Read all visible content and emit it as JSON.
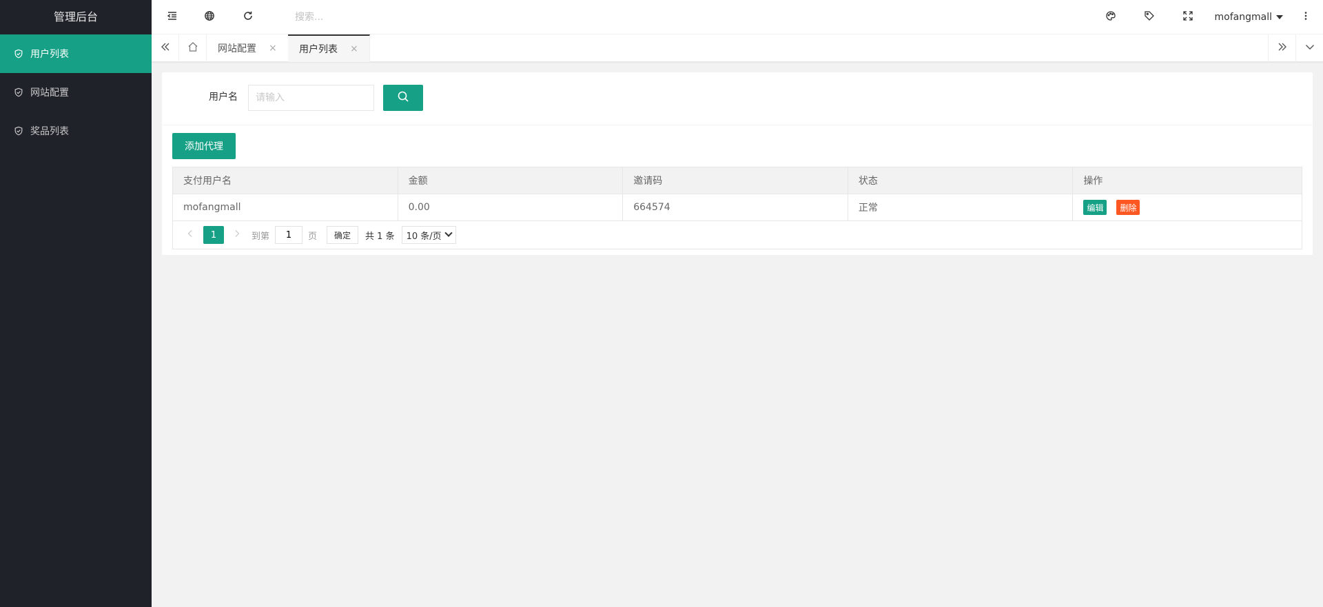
{
  "app": {
    "title": "管理后台"
  },
  "sidebar": {
    "items": [
      {
        "label": "用户列表",
        "active": true
      },
      {
        "label": "网站配置",
        "active": false
      },
      {
        "label": "奖品列表",
        "active": false
      }
    ]
  },
  "header": {
    "search_placeholder": "搜索...",
    "username": "mofangmall"
  },
  "tabs": {
    "items": [
      {
        "label": "网站配置",
        "close": "×"
      },
      {
        "label": "用户列表",
        "close": "×"
      }
    ]
  },
  "filter": {
    "username_label": "用户名",
    "username_placeholder": "请输入"
  },
  "toolbar": {
    "add_label": "添加代理"
  },
  "table": {
    "columns": [
      "支付用户名",
      "金额",
      "邀请码",
      "状态",
      "操作"
    ],
    "rows": [
      {
        "username": "mofangmall",
        "amount": "0.00",
        "invite_code": "664574",
        "status": "正常",
        "edit_label": "编辑",
        "delete_label": "删除"
      }
    ]
  },
  "pager": {
    "current": "1",
    "goto_label": "到第",
    "goto_value": "1",
    "page_unit": "页",
    "confirm_label": "确定",
    "total": "共 1 条",
    "page_size": "10 条/页"
  },
  "colors": {
    "accent": "#16a085",
    "danger": "#ff5722",
    "sidebar_bg": "#20222a"
  }
}
